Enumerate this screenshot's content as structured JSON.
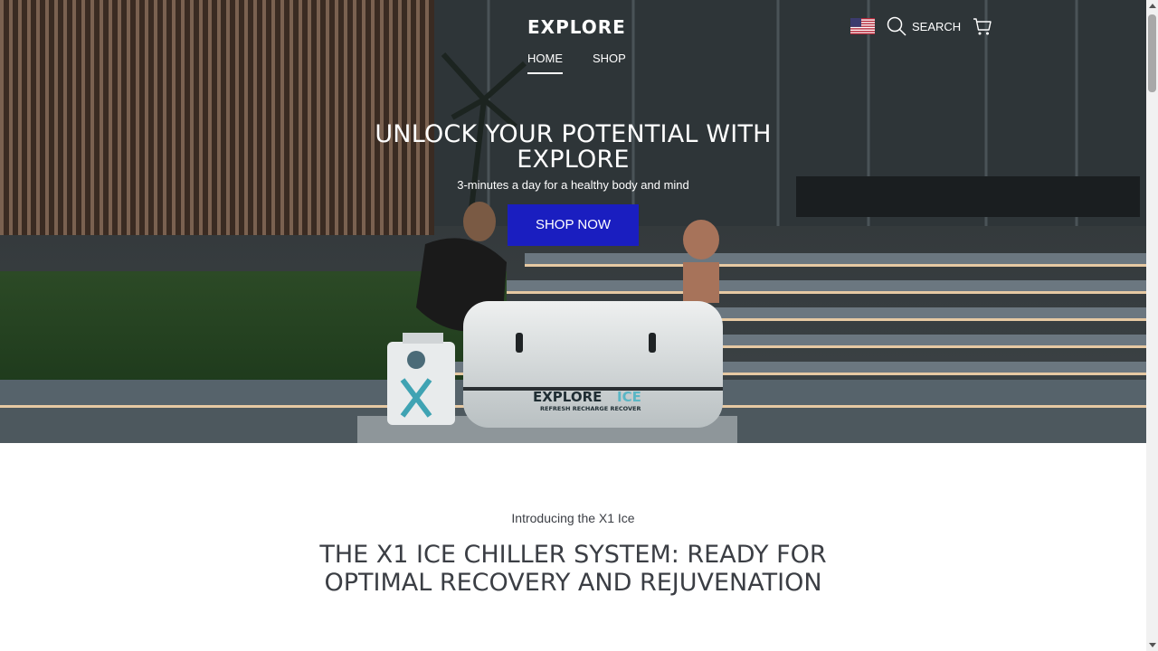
{
  "header": {
    "logo_text": "EXPLORE",
    "nav": [
      {
        "label": "HOME",
        "active": true
      },
      {
        "label": "SHOP",
        "active": false
      }
    ],
    "search_label": "SEARCH",
    "icons": {
      "flag": "us-flag-icon",
      "search": "search-icon",
      "cart": "cart-icon"
    }
  },
  "hero": {
    "title": "UNLOCK YOUR POTENTIAL WITH EXPLORE",
    "subtitle": "3-minutes a day for a healthy body and mind",
    "cta_label": "SHOP NOW",
    "tub_brand": "EXPLORE",
    "tub_brand_accent": "ICE",
    "tub_tagline": "REFRESH RECHARGE RECOVER"
  },
  "intro": {
    "label": "Introducing the X1 Ice",
    "heading_line1": "THE X1 ICE CHILLER SYSTEM: READY FOR",
    "heading_line2": "OPTIMAL RECOVERY AND REJUVENATION"
  },
  "colors": {
    "cta": "#1a1ec0",
    "text_dark": "#3b3e44",
    "white": "#ffffff"
  }
}
